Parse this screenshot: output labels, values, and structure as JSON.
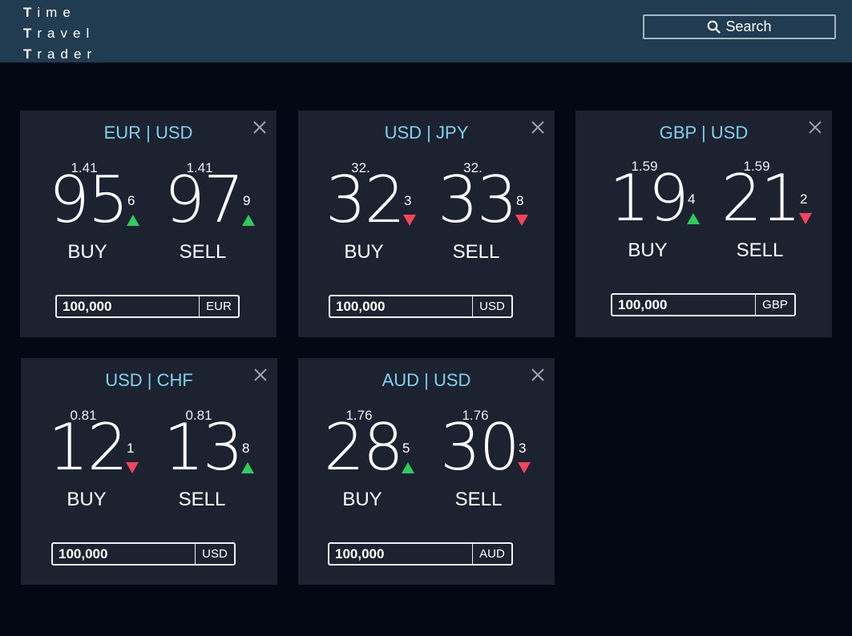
{
  "header": {
    "logo_lines": [
      {
        "first": "T",
        "rest": "ime"
      },
      {
        "first": "T",
        "rest": "ravel"
      },
      {
        "first": "T",
        "rest": "rader"
      }
    ],
    "search_label": "Search"
  },
  "colors": {
    "topbar": "#213b51",
    "background": "#020814",
    "tile": "#1d2230",
    "pair_title": "#7fd1ee",
    "up": "#2ecc5e",
    "down": "#f2445a"
  },
  "tiles": [
    {
      "pair": "EUR | USD",
      "buy": {
        "small": "1.41",
        "big": "95",
        "pip": "6",
        "direction": "up",
        "label": "BUY"
      },
      "sell": {
        "small": "1.41",
        "big": "97",
        "pip": "9",
        "direction": "up",
        "label": "SELL"
      },
      "amount": "100,000",
      "currency": "EUR"
    },
    {
      "pair": "USD | JPY",
      "buy": {
        "small": "32.",
        "big": "32",
        "pip": "3",
        "direction": "down",
        "label": "BUY"
      },
      "sell": {
        "small": "32.",
        "big": "33",
        "pip": "8",
        "direction": "down",
        "label": "SELL"
      },
      "amount": "100,000",
      "currency": "USD"
    },
    {
      "pair": "GBP | USD",
      "buy": {
        "small": "1.59",
        "big": "19",
        "pip": "4",
        "direction": "up",
        "label": "BUY"
      },
      "sell": {
        "small": "1.59",
        "big": "21",
        "pip": "2",
        "direction": "down",
        "label": "SELL"
      },
      "amount": "100,000",
      "currency": "GBP"
    },
    {
      "pair": "USD | CHF",
      "buy": {
        "small": "0.81",
        "big": "12",
        "pip": "1",
        "direction": "down",
        "label": "BUY"
      },
      "sell": {
        "small": "0.81",
        "big": "13",
        "pip": "8",
        "direction": "up",
        "label": "SELL"
      },
      "amount": "100,000",
      "currency": "USD"
    },
    {
      "pair": "AUD | USD",
      "buy": {
        "small": "1.76",
        "big": "28",
        "pip": "5",
        "direction": "up",
        "label": "BUY"
      },
      "sell": {
        "small": "1.76",
        "big": "30",
        "pip": "3",
        "direction": "down",
        "label": "SELL"
      },
      "amount": "100,000",
      "currency": "AUD"
    }
  ]
}
